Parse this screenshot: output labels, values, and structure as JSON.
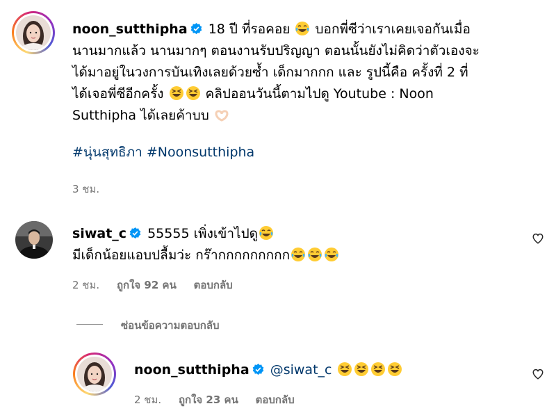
{
  "comments": [
    {
      "username": "noon_sutthipha",
      "text_1": " 18 ปี ที่รอคอย ",
      "text_2": " บอกพี่ซีว่าเราเคยเจอกันเมื่อ",
      "line2": "นานมากแล้ว นานมากๆ ตอนงานรับปริญญา ตอนนั้นยังไม่คิดว่าตัวเองจะ",
      "line3": "ได้มาอยู่ในวงการบันเทิงเลยด้วยซ้ำ เด็กมากกก และ รูปนี้คือ ครั้งที่ 2 ที่",
      "line4_a": "ได้เจอพี่ซีอีกครั้ง ",
      "line4_b": " คลิปออนวันนี้ตามไปดู Youtube : Noon",
      "line5": "Sutthipha ได้เลยค้าบบ ",
      "hashtag_1": "#นุ่นสุทธิภา",
      "hashtag_2": "#Noonsutthipha",
      "time": "3 ชม."
    },
    {
      "username": "siwat_c",
      "text_1": " 55555 เพิ่งเข้าไปดู",
      "line2": "มีเด็กน้อยแอบปลื้มว่ะ กร๊ากกกกกกกกก",
      "time": "2 ชม.",
      "likes": "ถูกใจ 92 คน",
      "reply_label": "ตอบกลับ"
    }
  ],
  "hide_replies_label": "ซ่อนข้อความตอบกลับ",
  "reply": {
    "username": "noon_sutthipha",
    "mention": "@siwat_c",
    "time": "2 ชม.",
    "likes": "ถูกใจ 23 คน",
    "reply_label": "ตอบกลับ"
  },
  "colors": {
    "verified": "#0095f6",
    "hashtag": "#00376b",
    "meta": "#737373"
  }
}
